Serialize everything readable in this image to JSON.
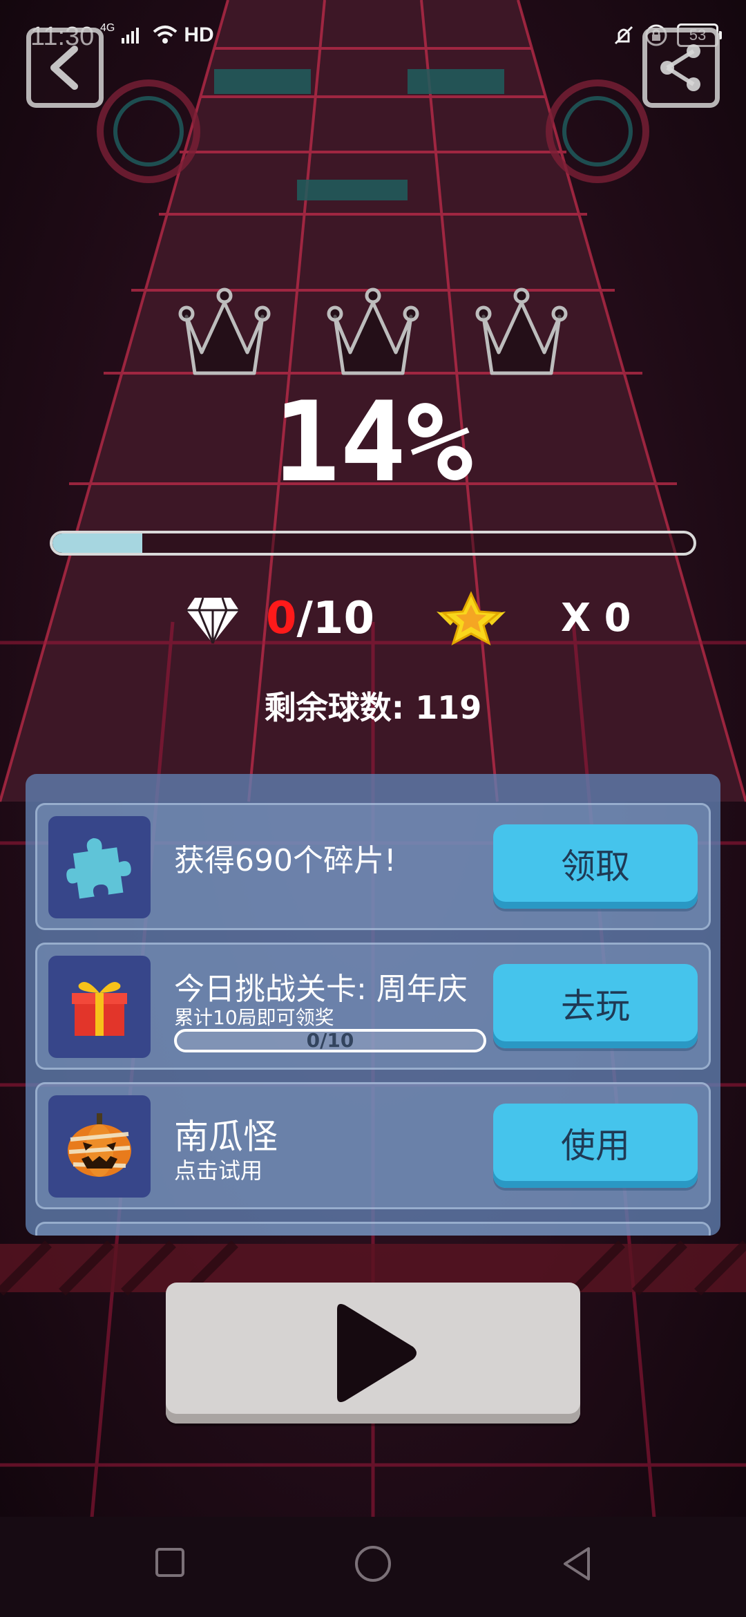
{
  "status_bar": {
    "time": "11:30",
    "network": "4G",
    "hd": "HD",
    "battery": "53"
  },
  "level": {
    "percent_text": "14%",
    "progress": 0.14,
    "crowns_earned": 0,
    "crowns_total": 3
  },
  "gems": {
    "collected": "0",
    "total": "/10"
  },
  "stars": {
    "count": "X 0"
  },
  "balls_remaining": {
    "label": "剩余球数:",
    "value": "119"
  },
  "tasks": [
    {
      "icon": "puzzle-piece-icon",
      "title": "获得690个碎片!",
      "subtitle": "",
      "button": "领取"
    },
    {
      "icon": "gift-box-icon",
      "title": "今日挑战关卡: 周年庆",
      "subtitle": "累计10局即可领奖",
      "progress_text": "0/10",
      "progress": 0,
      "button": "去玩"
    },
    {
      "icon": "pumpkin-monster-icon",
      "title": "南瓜怪",
      "subtitle": "点击试用",
      "button": "使用"
    }
  ],
  "colors": {
    "accent_button": "#45c4ec",
    "progress_fill": "#a6d6e0",
    "gem_count_highlight": "#ff1a1a",
    "panel": "#6080b2"
  }
}
